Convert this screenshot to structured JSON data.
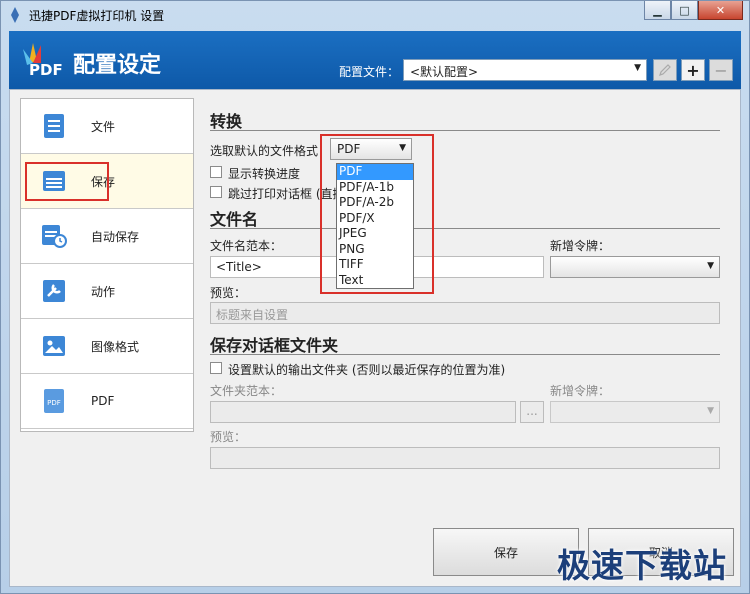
{
  "window": {
    "title": "迅捷PDF虚拟打印机 设置",
    "controls": [
      "minimize-icon",
      "maximize-icon",
      "close-icon"
    ]
  },
  "header": {
    "logo_text": "PDF",
    "title": "配置设定",
    "profile_label": "配置文件：",
    "profile_value": "<默认配置>",
    "buttons": [
      "edit-icon",
      "plus-icon",
      "minus-icon"
    ]
  },
  "sidebar": {
    "items": [
      {
        "label": "文件",
        "icon": "document-icon"
      },
      {
        "label": "保存",
        "icon": "save-icon"
      },
      {
        "label": "自动保存",
        "icon": "auto-save-icon"
      },
      {
        "label": "动作",
        "icon": "action-icon"
      },
      {
        "label": "图像格式",
        "icon": "image-icon"
      },
      {
        "label": "PDF",
        "icon": "pdf-icon"
      }
    ],
    "active_index": 1
  },
  "convert": {
    "title": "转换",
    "format_label": "选取默认的文件格式",
    "format_value": "PDF",
    "format_options": [
      "PDF",
      "PDF/A-1b",
      "PDF/A-2b",
      "PDF/X",
      "JPEG",
      "PNG",
      "TIFF",
      "Text"
    ],
    "show_progress": "显示转换进度",
    "skip_dialog": "跳过打印对话框 (直接"
  },
  "filename": {
    "title": "文件名",
    "template_label": "文件名范本：",
    "template_value": "<Title>",
    "token_label": "新增令牌：",
    "preview_label": "预览：",
    "preview_value": "标题来自设置"
  },
  "save_dialog": {
    "title": "保存对话框文件夹",
    "default_folder": "设置默认的输出文件夹 (否则以最近保存的位置为准)",
    "folder_template_label": "文件夹范本：",
    "browse": "...",
    "token_label": "新增令牌：",
    "preview_label": "预览："
  },
  "footer": {
    "save": "保存",
    "cancel": "取消"
  },
  "watermark": "极速下载站",
  "colors": {
    "header_blue": "#1565b8",
    "highlight_red": "#d9302a",
    "selection_blue": "#3399ff"
  }
}
